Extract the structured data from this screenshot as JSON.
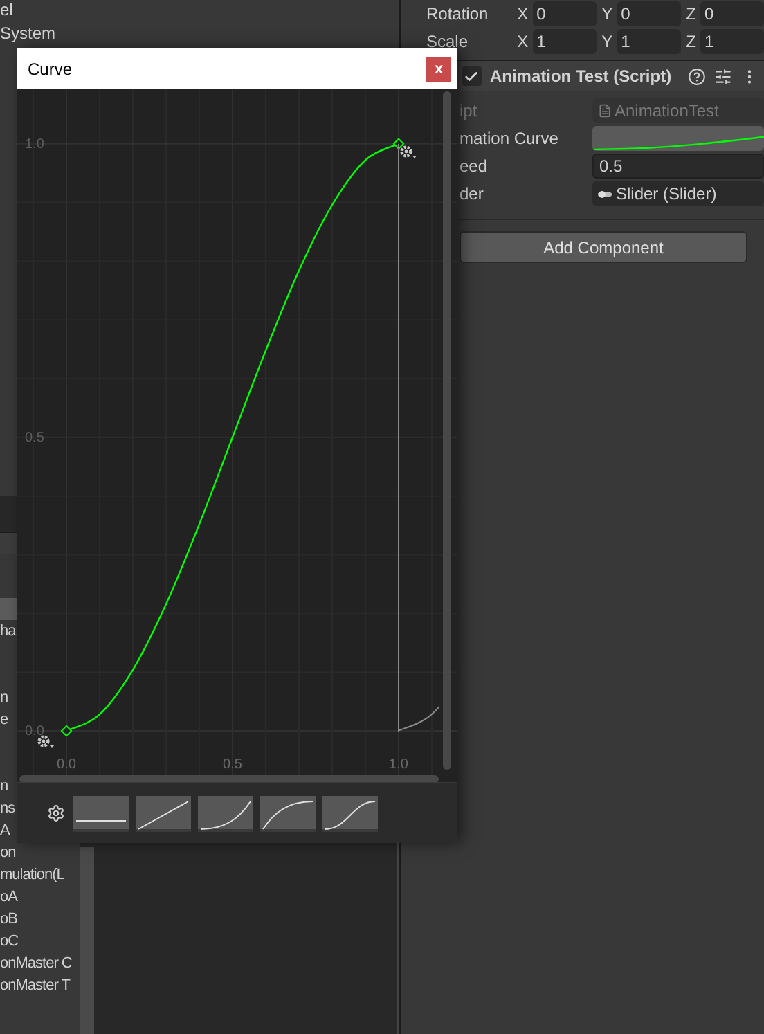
{
  "hierarchy": {
    "top_rows": [
      "el",
      "System"
    ],
    "rows": [
      {
        "selected": false
      },
      {
        "selected": false
      },
      {
        "selected": true
      },
      {
        "text": "ha",
        "selected": false
      },
      {
        "selected": false
      },
      {
        "selected": false
      },
      {
        "text": "n",
        "selected": false
      },
      {
        "text": "e",
        "selected": false
      },
      {
        "selected": false
      },
      {
        "selected": false
      },
      {
        "text": "n",
        "selected": false
      },
      {
        "text": "ns",
        "selected": false
      },
      {
        "text": "A",
        "selected": false
      },
      {
        "text": "on",
        "selected": false
      },
      {
        "text": "mulation(L",
        "selected": false
      },
      {
        "text": "oA",
        "selected": false
      },
      {
        "text": "oB",
        "selected": false
      },
      {
        "text": "oC",
        "selected": false
      },
      {
        "text": "onMaster C",
        "selected": false
      },
      {
        "text": "onMaster T",
        "selected": false
      }
    ]
  },
  "inspector": {
    "transform": [
      {
        "label": "Rotation",
        "axes": [
          {
            "axis": "X",
            "value": "0"
          },
          {
            "axis": "Y",
            "value": "0"
          },
          {
            "axis": "Z",
            "value": "0"
          }
        ]
      },
      {
        "label": "Scale",
        "axes": [
          {
            "axis": "X",
            "value": "1"
          },
          {
            "axis": "Y",
            "value": "1"
          },
          {
            "axis": "Z",
            "value": "1"
          }
        ]
      }
    ],
    "component": {
      "title": "Animation Test (Script)",
      "enabled": true,
      "properties": [
        {
          "kind": "script",
          "label": "ipt",
          "value": "AnimationTest",
          "disabled": true
        },
        {
          "kind": "curve",
          "label": "mation Curve",
          "disabled": false
        },
        {
          "kind": "number",
          "label": "eed",
          "value": "0.5",
          "disabled": false
        },
        {
          "kind": "object",
          "label": "der",
          "value": "Slider (Slider)",
          "disabled": false
        }
      ]
    },
    "add_button": "Add Component"
  },
  "curve_window": {
    "title": "Curve",
    "close": "x",
    "chart_data": {
      "type": "line",
      "x": [
        0,
        0.1,
        0.2,
        0.3,
        0.4,
        0.5,
        0.6,
        0.7,
        0.8,
        0.9,
        1
      ],
      "series": [
        {
          "color": "#00ff00",
          "values": [
            0,
            0.028,
            0.104,
            0.216,
            0.352,
            0.5,
            0.648,
            0.784,
            0.896,
            0.972,
            1
          ]
        }
      ],
      "grid": true,
      "xlim": [
        -0.15,
        1.175
      ],
      "ylim": [
        -0.191,
        1.094
      ],
      "xticks": [
        {
          "value": 0,
          "label": "0.0"
        },
        {
          "value": 0.5,
          "label": "0.5"
        },
        {
          "value": 1,
          "label": "1.0"
        }
      ],
      "yticks": [
        {
          "value": 0,
          "label": "0.0"
        },
        {
          "value": 0.5,
          "label": "0.5"
        },
        {
          "value": 1,
          "label": "1.0"
        }
      ]
    },
    "presets": [
      {
        "kind": "flat"
      },
      {
        "kind": "linear"
      },
      {
        "kind": "ease_in"
      },
      {
        "kind": "ease_out"
      },
      {
        "kind": "ease_in_out"
      }
    ]
  }
}
